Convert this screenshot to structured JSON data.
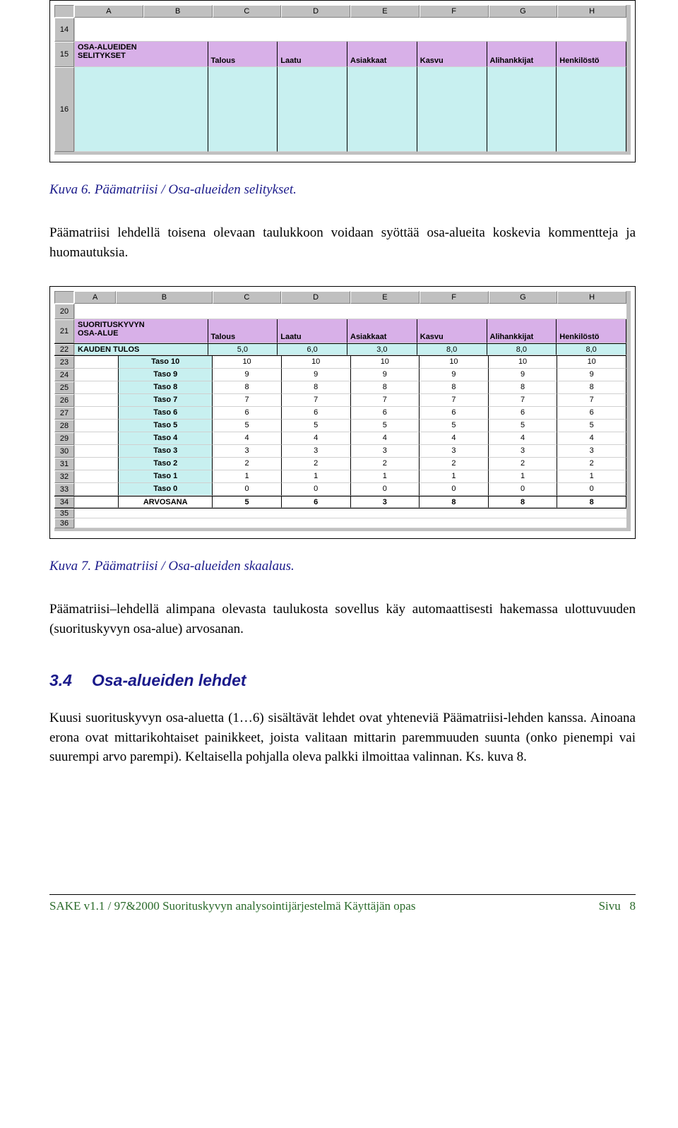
{
  "fig1": {
    "columns": [
      "A",
      "B",
      "C",
      "D",
      "E",
      "F",
      "G",
      "H"
    ],
    "row_blank": "14",
    "row_headers": "15",
    "row_body": "16",
    "header_left_line1": "OSA-ALUEIDEN",
    "header_left_line2": "SELITYKSET",
    "headers": [
      "Talous",
      "Laatu",
      "Asiakkaat",
      "Kasvu",
      "Alihankkijat",
      "Henkilöstö"
    ]
  },
  "caption1": "Kuva 6. Päämatriisi / Osa-alueiden selitykset.",
  "para1": "Päämatriisi lehdellä toisena olevaan taulukkoon voidaan syöttää osa-alueita koskevia kommentteja ja huomautuksia.",
  "fig2": {
    "columns": [
      "A",
      "B",
      "C",
      "D",
      "E",
      "F",
      "G",
      "H"
    ],
    "row_start": 20,
    "header_left_line1": "SUORITUSKYVYN",
    "header_left_line2": "OSA-ALUE",
    "headers": [
      "Talous",
      "Laatu",
      "Asiakkaat",
      "Kasvu",
      "Alihankkijat",
      "Henkilöstö"
    ],
    "kauden_label": "KAUDEN TULOS",
    "kauden_values": [
      "5,0",
      "6,0",
      "3,0",
      "8,0",
      "8,0",
      "8,0"
    ],
    "taso_rows": [
      {
        "label": "Taso 10",
        "vals": [
          "10",
          "10",
          "10",
          "10",
          "10",
          "10"
        ]
      },
      {
        "label": "Taso 9",
        "vals": [
          "9",
          "9",
          "9",
          "9",
          "9",
          "9"
        ]
      },
      {
        "label": "Taso 8",
        "vals": [
          "8",
          "8",
          "8",
          "8",
          "8",
          "8"
        ]
      },
      {
        "label": "Taso 7",
        "vals": [
          "7",
          "7",
          "7",
          "7",
          "7",
          "7"
        ]
      },
      {
        "label": "Taso 6",
        "vals": [
          "6",
          "6",
          "6",
          "6",
          "6",
          "6"
        ]
      },
      {
        "label": "Taso 5",
        "vals": [
          "5",
          "5",
          "5",
          "5",
          "5",
          "5"
        ]
      },
      {
        "label": "Taso 4",
        "vals": [
          "4",
          "4",
          "4",
          "4",
          "4",
          "4"
        ]
      },
      {
        "label": "Taso 3",
        "vals": [
          "3",
          "3",
          "3",
          "3",
          "3",
          "3"
        ]
      },
      {
        "label": "Taso 2",
        "vals": [
          "2",
          "2",
          "2",
          "2",
          "2",
          "2"
        ]
      },
      {
        "label": "Taso 1",
        "vals": [
          "1",
          "1",
          "1",
          "1",
          "1",
          "1"
        ]
      },
      {
        "label": "Taso 0",
        "vals": [
          "0",
          "0",
          "0",
          "0",
          "0",
          "0"
        ]
      }
    ],
    "arvosana_label": "ARVOSANA",
    "arvosana_values": [
      "5",
      "6",
      "3",
      "8",
      "8",
      "8"
    ],
    "trailing_rows": [
      "35",
      "36"
    ]
  },
  "caption2": "Kuva 7. Päämatriisi / Osa-alueiden skaalaus.",
  "para2": "Päämatriisi–lehdellä alimpana olevasta taulukosta sovellus käy automaattisesti hakemassa ulottuvuuden (suorituskyvyn osa-alue) arvosanan.",
  "section": {
    "num": "3.4",
    "title": "Osa-alueiden lehdet"
  },
  "para3": "Kuusi suorituskyvyn osa-aluetta (1…6) sisältävät lehdet ovat yhteneviä Päämatriisi-lehden kanssa. Ainoana erona ovat mittarikohtaiset painikkeet, joista valitaan mittarin paremmuuden suunta (onko pienempi vai suurempi arvo parempi). Keltaisella pohjalla oleva palkki ilmoittaa valinnan. Ks. kuva 8.",
  "footer": {
    "left": "SAKE v1.1 / 97&2000   Suorituskyvyn analysointijärjestelmä   Käyttäjän opas",
    "right_label": "Sivu",
    "right_num": "8"
  },
  "chart_data": {
    "type": "table",
    "title": "Päämatriisi / Osa-alueiden skaalaus",
    "categories": [
      "Talous",
      "Laatu",
      "Asiakkaat",
      "Kasvu",
      "Alihankkijat",
      "Henkilöstö"
    ],
    "series": [
      {
        "name": "KAUDEN TULOS",
        "values": [
          5.0,
          6.0,
          3.0,
          8.0,
          8.0,
          8.0
        ]
      },
      {
        "name": "Taso 10",
        "values": [
          10,
          10,
          10,
          10,
          10,
          10
        ]
      },
      {
        "name": "Taso 9",
        "values": [
          9,
          9,
          9,
          9,
          9,
          9
        ]
      },
      {
        "name": "Taso 8",
        "values": [
          8,
          8,
          8,
          8,
          8,
          8
        ]
      },
      {
        "name": "Taso 7",
        "values": [
          7,
          7,
          7,
          7,
          7,
          7
        ]
      },
      {
        "name": "Taso 6",
        "values": [
          6,
          6,
          6,
          6,
          6,
          6
        ]
      },
      {
        "name": "Taso 5",
        "values": [
          5,
          5,
          5,
          5,
          5,
          5
        ]
      },
      {
        "name": "Taso 4",
        "values": [
          4,
          4,
          4,
          4,
          4,
          4
        ]
      },
      {
        "name": "Taso 3",
        "values": [
          3,
          3,
          3,
          3,
          3,
          3
        ]
      },
      {
        "name": "Taso 2",
        "values": [
          2,
          2,
          2,
          2,
          2,
          2
        ]
      },
      {
        "name": "Taso 1",
        "values": [
          1,
          1,
          1,
          1,
          1,
          1
        ]
      },
      {
        "name": "Taso 0",
        "values": [
          0,
          0,
          0,
          0,
          0,
          0
        ]
      },
      {
        "name": "ARVOSANA",
        "values": [
          5,
          6,
          3,
          8,
          8,
          8
        ]
      }
    ]
  }
}
